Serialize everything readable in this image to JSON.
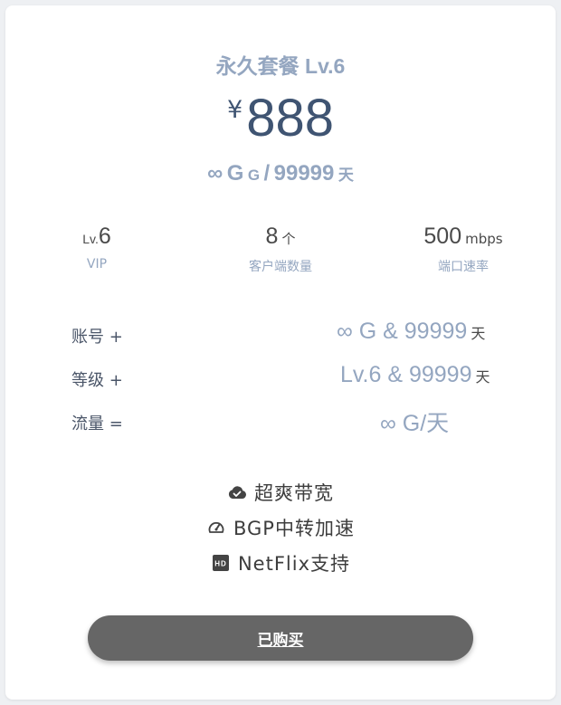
{
  "plan": {
    "title": "永久套餐 Lv.6",
    "currency": "¥",
    "price": "888",
    "quota_symbol": "∞",
    "quota_unit_big": "G",
    "quota_unit_small": "G",
    "quota_sep": "/",
    "quota_days": "99999",
    "quota_days_unit": "天"
  },
  "stats": {
    "level": {
      "prefix": "Lv.",
      "value": "6",
      "label": "VIP"
    },
    "clients": {
      "value": "8",
      "unit": "个",
      "label": "客户端数量"
    },
    "speed": {
      "value": "500",
      "unit": "mbps",
      "label": "端口速率"
    }
  },
  "formula": {
    "account": {
      "label": "账号 +",
      "value": "∞ G & 99999",
      "unit": "天"
    },
    "level": {
      "label": "等级 +",
      "value": "Lv.6 & 99999",
      "unit": "天"
    },
    "traffic": {
      "label": "流量 =",
      "value": "∞ G/天"
    }
  },
  "features": [
    {
      "icon": "cloud-check-icon",
      "label": "超爽带宽"
    },
    {
      "icon": "speedometer-icon",
      "label": "BGP中转加速"
    },
    {
      "icon": "hd-icon",
      "label": "NetFlix支持"
    }
  ],
  "button": {
    "label": "已购买"
  },
  "colors": {
    "accent": "#94a6c0",
    "price": "#3f5472",
    "button": "#666666"
  }
}
